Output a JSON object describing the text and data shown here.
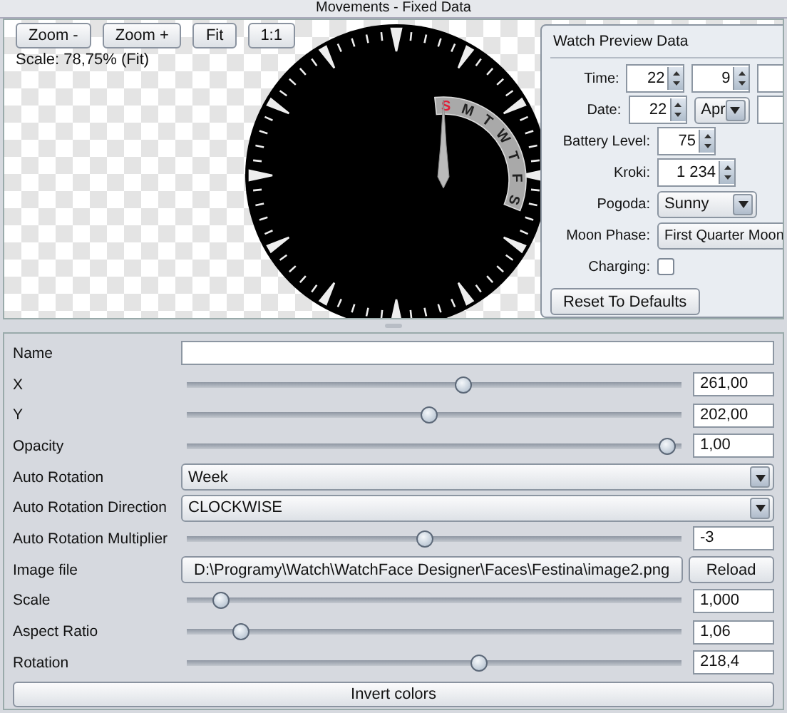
{
  "window": {
    "title": "Movements - Fixed Data"
  },
  "toolbar": {
    "buttons": [
      "Zoom -",
      "Zoom +",
      "Fit",
      "1:1"
    ],
    "scale": "Scale:  78,75%  (Fit)"
  },
  "watch": {
    "days": [
      {
        "label": "S",
        "selected": true
      },
      {
        "label": "M",
        "selected": false
      },
      {
        "label": "T",
        "selected": false
      },
      {
        "label": "W",
        "selected": false
      },
      {
        "label": "T",
        "selected": false
      },
      {
        "label": "F",
        "selected": false
      },
      {
        "label": "S",
        "selected": false
      }
    ]
  },
  "preview_panel": {
    "title": "Watch Preview Data",
    "rows": [
      {
        "kind": "spinners",
        "label": "Time:",
        "values": [
          "22",
          "9"
        ]
      },
      {
        "kind": "date",
        "label": "Date:",
        "day": "22",
        "month": "Apr"
      },
      {
        "kind": "spinners",
        "label": "Battery Level:",
        "values": [
          "75"
        ]
      },
      {
        "kind": "wide_spinner",
        "label": "Kroki:",
        "values": [
          "1 234"
        ]
      },
      {
        "kind": "combo",
        "label": "Pogoda:",
        "value": "Sunny"
      },
      {
        "kind": "wide_combo",
        "label": "Moon Phase:",
        "value": "First Quarter Moon"
      },
      {
        "kind": "checkbox",
        "label": "Charging:",
        "checked": false
      }
    ],
    "reset_button": "Reset To Defaults"
  },
  "properties": [
    {
      "kind": "text",
      "label": "Name"
    },
    {
      "kind": "slider",
      "label": "X",
      "level": 0.56,
      "value": "261,00"
    },
    {
      "kind": "slider",
      "label": "Y",
      "level": 0.49,
      "value": "202,00"
    },
    {
      "kind": "slider",
      "label": "Opacity",
      "level": 0.97,
      "value": "1,00"
    },
    {
      "kind": "combo",
      "label": "Auto Rotation",
      "value": "Week"
    },
    {
      "kind": "combo",
      "label": "Auto Rotation Direction",
      "value": "CLOCKWISE"
    },
    {
      "kind": "slider",
      "label": "Auto Rotation Multiplier",
      "level": 0.48,
      "value": "-3"
    },
    {
      "kind": "file",
      "label": "Image file",
      "value": "D:\\Programy\\Watch\\WatchFace Designer\\Faces\\Festina\\image2.png",
      "button": "Reload"
    },
    {
      "kind": "slider",
      "label": "Scale",
      "level": 0.07,
      "value": "1,000"
    },
    {
      "kind": "slider",
      "label": "Aspect Ratio",
      "level": 0.11,
      "value": "1,06"
    },
    {
      "kind": "slider",
      "label": "Rotation",
      "level": 0.59,
      "value": "218,4"
    }
  ],
  "invert_button": "Invert colors"
}
